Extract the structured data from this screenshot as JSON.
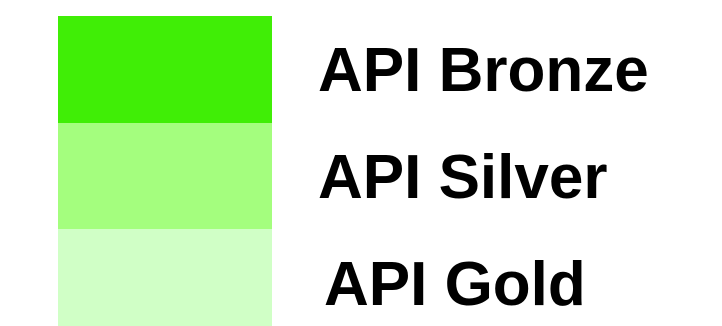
{
  "legend": {
    "items": [
      {
        "label": "API Bronze",
        "color": "#40ee06"
      },
      {
        "label": "API Silver",
        "color": "#a4fe7e"
      },
      {
        "label": "API Gold",
        "color": "#d0ffc6"
      }
    ]
  }
}
